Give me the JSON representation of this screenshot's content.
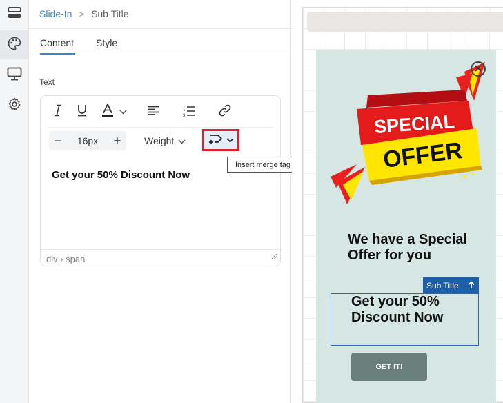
{
  "breadcrumb": {
    "parent": "Slide-In",
    "separator": ">",
    "current": "Sub Title"
  },
  "tabs": [
    {
      "label": "Content",
      "active": true
    },
    {
      "label": "Style",
      "active": false
    }
  ],
  "text_field": {
    "label": "Text",
    "font_size": "16px",
    "weight_label": "Weight",
    "content": "Get your 50% Discount Now",
    "status_path": "div › span",
    "tooltip": "Insert merge tag"
  },
  "toolbar_icons": [
    "italic-icon",
    "underline-icon",
    "text-color-icon",
    "align-left-icon",
    "ordered-list-icon",
    "link-icon",
    "merge-tag-icon"
  ],
  "rail_icons": [
    "layers-icon",
    "palette-icon",
    "monitor-icon",
    "gear-icon"
  ],
  "preview": {
    "badge_line1": "SPECIAL",
    "badge_line2": "OFFER",
    "heading": "We have a Special Offer for you",
    "selected_label": "Sub Title",
    "subtitle": "Get your 50% Discount Now",
    "button_label": "GET IT!"
  },
  "colors": {
    "accent": "#3d86c6",
    "highlight": "#d9232e",
    "slidein_bg": "#d6e6e3",
    "selection": "#1f5fa8",
    "cta": "#6b7f7a"
  }
}
